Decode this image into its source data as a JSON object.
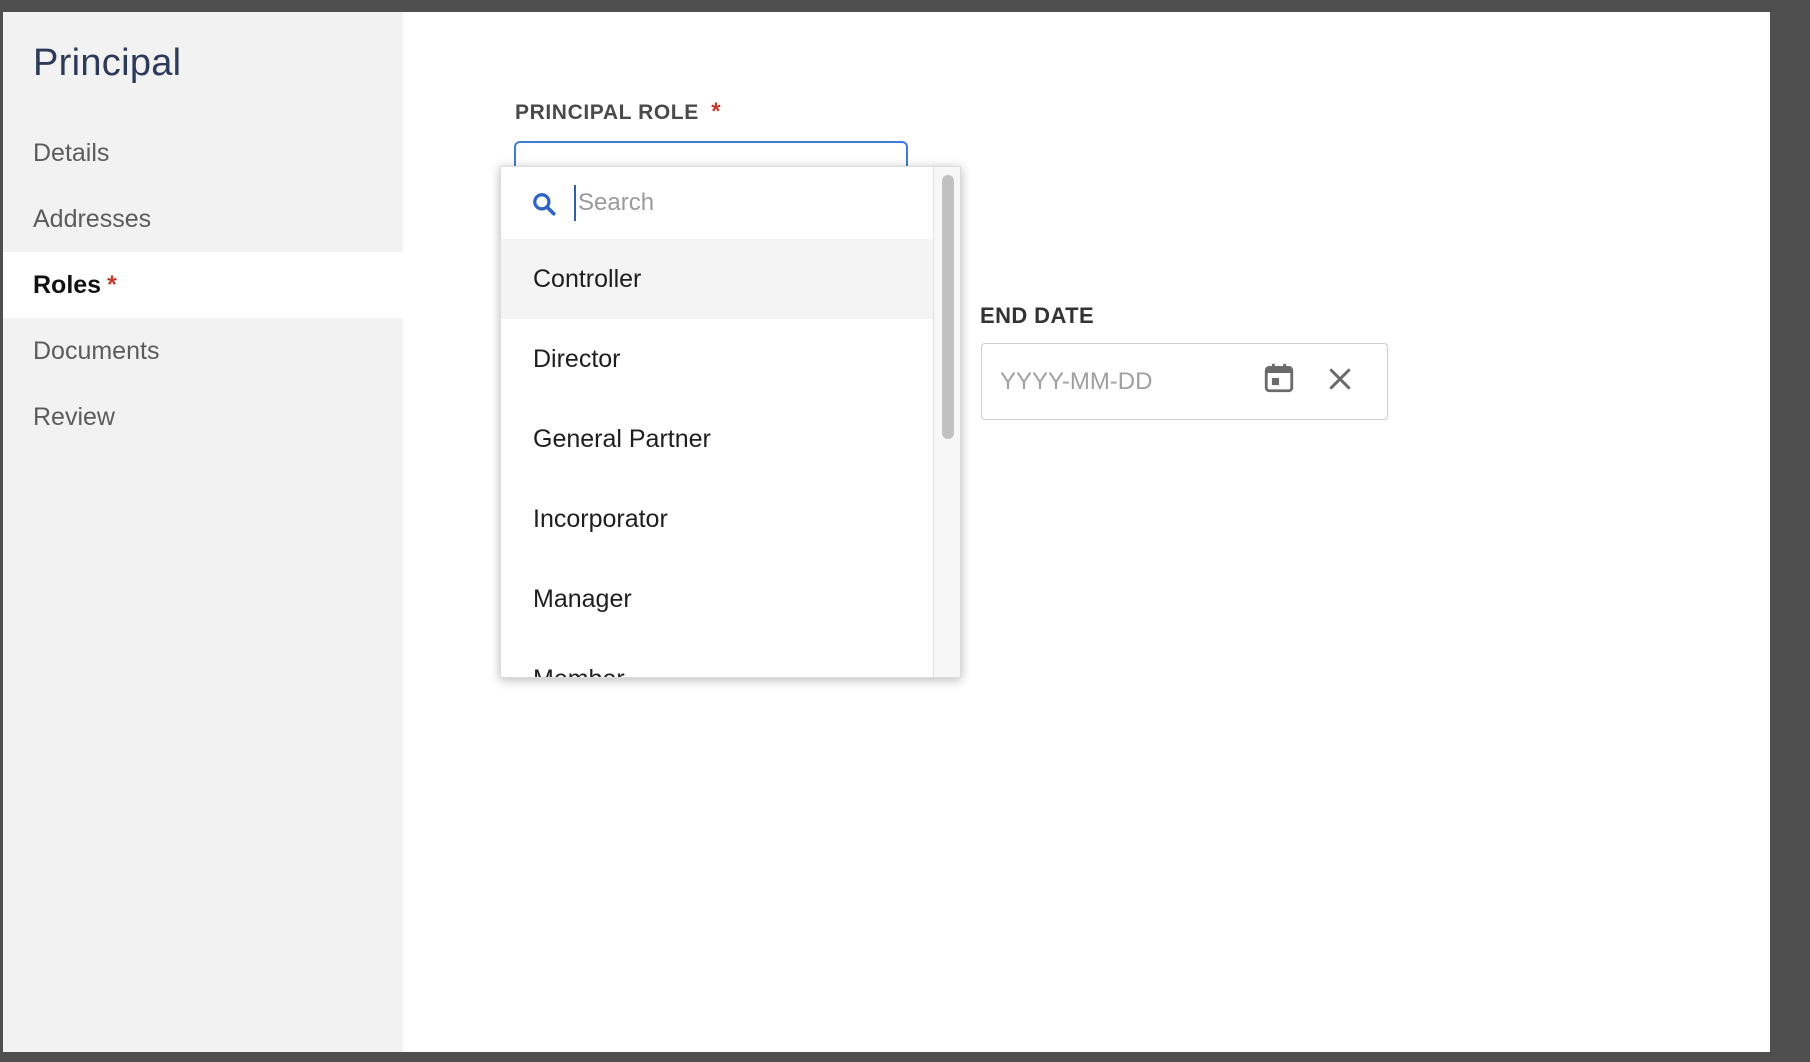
{
  "sidebar": {
    "title": "Principal",
    "items": [
      {
        "label": "Details",
        "required": false
      },
      {
        "label": "Addresses",
        "required": false
      },
      {
        "label": "Roles",
        "required": true
      },
      {
        "label": "Documents",
        "required": false
      },
      {
        "label": "Review",
        "required": false
      }
    ],
    "active_item": "Roles",
    "required_marker": "*"
  },
  "form": {
    "principal_role": {
      "label": "PRINCIPAL ROLE",
      "required_marker": "*"
    },
    "dropdown": {
      "search_placeholder": "Search",
      "options": [
        "Controller",
        "Director",
        "General Partner",
        "Incorporator",
        "Manager",
        "Member"
      ],
      "highlighted": "Controller"
    },
    "end_date": {
      "label": "END DATE",
      "placeholder": "YYYY-MM-DD",
      "value": ""
    }
  },
  "colors": {
    "accent": "#3f7bd9",
    "required": "#c0392b",
    "sidebar_bg": "#f2f2f2",
    "title": "#2e3a5a"
  },
  "icons": {
    "search": "search-icon",
    "calendar": "calendar-icon",
    "clear": "close-icon"
  }
}
